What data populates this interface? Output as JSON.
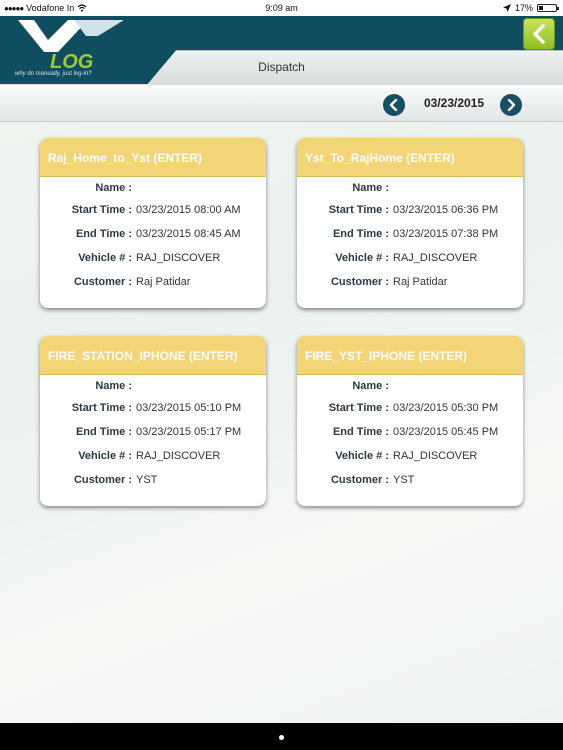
{
  "status_bar": {
    "carrier": "Vodafone In",
    "time": "9:09 am",
    "battery": "17%"
  },
  "header": {
    "logo_text": "LOG",
    "tagline": "why do manually, just log-in?",
    "title": "Dispatch",
    "back_icon": "chevron-left-icon"
  },
  "date_nav": {
    "date": "03/23/2015",
    "prev_icon": "chevron-left-icon",
    "next_icon": "chevron-right-icon"
  },
  "labels": {
    "name": "Name :",
    "start": "Start Time :",
    "end": "End Time :",
    "vehicle": "Vehicle # :",
    "customer": "Customer :"
  },
  "cards": [
    {
      "title": "Raj_Home_to_Yst  (ENTER)",
      "name": "",
      "start": "03/23/2015 08:00 AM",
      "end": "03/23/2015 08:45 AM",
      "vehicle": "RAJ_DISCOVER",
      "customer": "Raj Patidar"
    },
    {
      "title": "Yst_To_RajHome  (ENTER)",
      "name": "",
      "start": "03/23/2015 06:36 PM",
      "end": "03/23/2015 07:38 PM",
      "vehicle": "RAJ_DISCOVER",
      "customer": "Raj Patidar"
    },
    {
      "title": "FIRE_STATION_IPHONE  (ENTER)",
      "name": "",
      "start": "03/23/2015 05:10 PM",
      "end": "03/23/2015 05:17 PM",
      "vehicle": "RAJ_DISCOVER",
      "customer": "YST"
    },
    {
      "title": "FIRE_YST_IPHONE  (ENTER)",
      "name": "",
      "start": "03/23/2015 05:30 PM",
      "end": "03/23/2015 05:45 PM",
      "vehicle": "RAJ_DISCOVER",
      "customer": "YST"
    }
  ],
  "colors": {
    "header_bg": "#0f4d60",
    "card_header": "#f3d477",
    "nav_circle": "#174f65",
    "back_button": "#9fcb2c"
  }
}
